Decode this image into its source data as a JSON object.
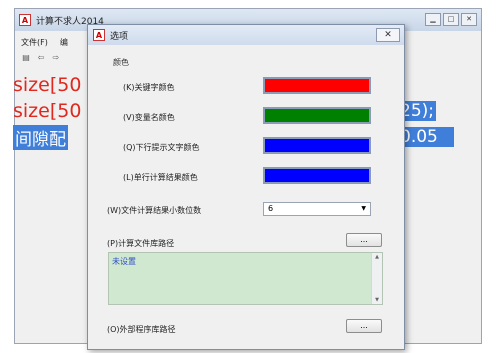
{
  "app": {
    "title": "计算不求人2014",
    "menu": [
      "文件(F)",
      "编"
    ],
    "code_line1": "size[50",
    "code_line2": "size[50",
    "code_line2_tail": "25);",
    "code_line3": "间隙配",
    "code_line3_tail": "0.05"
  },
  "dialog": {
    "title": "选项",
    "close_label": "✕",
    "color_section_label": "颜色",
    "color_rows": [
      {
        "label": "(K)关键字颜色",
        "color": "#ff0000"
      },
      {
        "label": "(V)变量名颜色",
        "color": "#008000"
      },
      {
        "label": "(Q)下行提示文字颜色",
        "color": "#0000ff"
      },
      {
        "label": "(L)单行计算结果颜色",
        "color": "#0000ff"
      }
    ],
    "decimal_label": "(W)文件计算结果小数位数",
    "decimal_value": "6",
    "lib_path_label": "(P)计算文件库路径",
    "lib_path_button": "...",
    "lib_path_value": "未设置",
    "ext_lib_label": "(O)外部程序库路径",
    "ext_lib_button": "..."
  }
}
